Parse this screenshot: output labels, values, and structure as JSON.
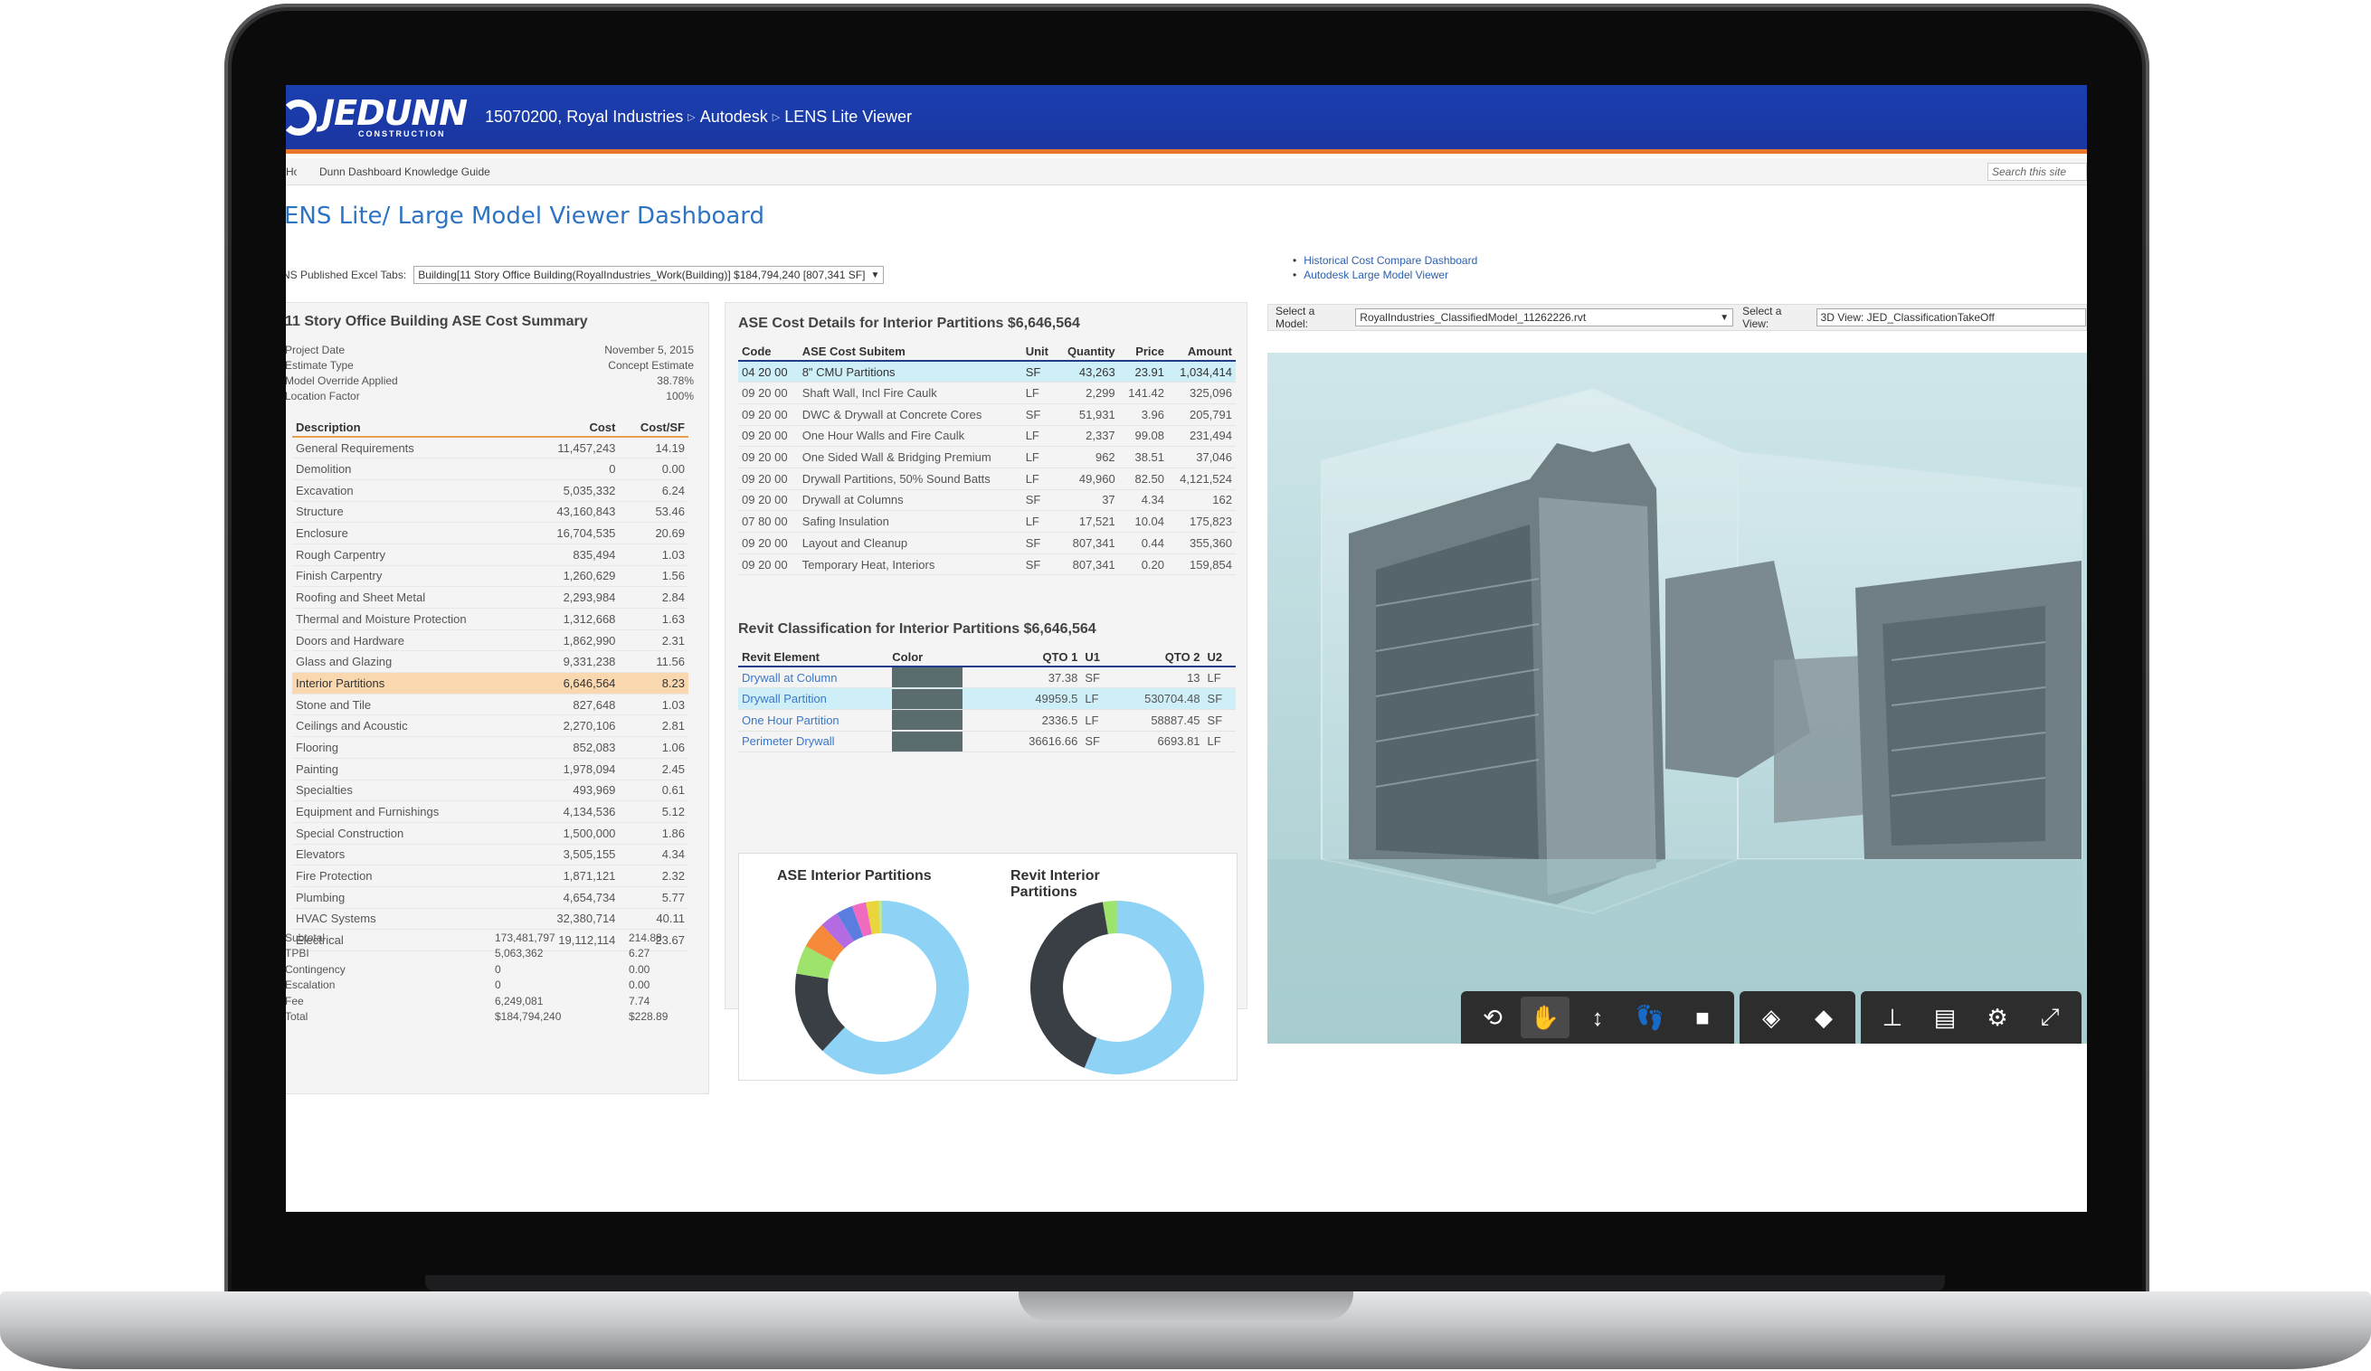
{
  "header": {
    "logo": "JEDUNN",
    "logo_sub": "CONSTRUCTION",
    "breadcrumbs": [
      "15070200, Royal Industries",
      "Autodesk",
      "LENS Lite Viewer"
    ]
  },
  "subnav": {
    "home": "Home",
    "guide": "Dunn Dashboard Knowledge Guide",
    "search_placeholder": "Search this site"
  },
  "page_title": "ENS Lite/ Large Model Viewer Dashboard",
  "links": [
    "Historical Cost Compare Dashboard",
    "Autodesk Large Model Viewer"
  ],
  "excel": {
    "label": "NS Published Excel Tabs:",
    "selected": "Building[11 Story Office Building(RoyalIndustries_Work(Building)] $184,794,240 [807,341 SF]"
  },
  "summary": {
    "title": "11 Story Office Building ASE Cost Summary",
    "project": [
      {
        "k": "Project Date",
        "v": "November 5, 2015"
      },
      {
        "k": "Estimate Type",
        "v": "Concept Estimate"
      },
      {
        "k": "Model Override Applied",
        "v": "38.78%"
      },
      {
        "k": "Location Factor",
        "v": "100%"
      }
    ],
    "headers": [
      "Description",
      "Cost",
      "Cost/SF"
    ],
    "rows": [
      [
        "General Requirements",
        "11,457,243",
        "14.19"
      ],
      [
        "Demolition",
        "0",
        "0.00"
      ],
      [
        "Excavation",
        "5,035,332",
        "6.24"
      ],
      [
        "Structure",
        "43,160,843",
        "53.46"
      ],
      [
        "Enclosure",
        "16,704,535",
        "20.69"
      ],
      [
        "Rough Carpentry",
        "835,494",
        "1.03"
      ],
      [
        "Finish Carpentry",
        "1,260,629",
        "1.56"
      ],
      [
        "Roofing and Sheet Metal",
        "2,293,984",
        "2.84"
      ],
      [
        "Thermal and Moisture Protection",
        "1,312,668",
        "1.63"
      ],
      [
        "Doors and Hardware",
        "1,862,990",
        "2.31"
      ],
      [
        "Glass and Glazing",
        "9,331,238",
        "11.56"
      ],
      [
        "Interior Partitions",
        "6,646,564",
        "8.23"
      ],
      [
        "Stone and Tile",
        "827,648",
        "1.03"
      ],
      [
        "Ceilings and Acoustic",
        "2,270,106",
        "2.81"
      ],
      [
        "Flooring",
        "852,083",
        "1.06"
      ],
      [
        "Painting",
        "1,978,094",
        "2.45"
      ],
      [
        "Specialties",
        "493,969",
        "0.61"
      ],
      [
        "Equipment and Furnishings",
        "4,134,536",
        "5.12"
      ],
      [
        "Special Construction",
        "1,500,000",
        "1.86"
      ],
      [
        "Elevators",
        "3,505,155",
        "4.34"
      ],
      [
        "Fire Protection",
        "1,871,121",
        "2.32"
      ],
      [
        "Plumbing",
        "4,654,734",
        "5.77"
      ],
      [
        "HVAC Systems",
        "32,380,714",
        "40.11"
      ],
      [
        "Electrical",
        "19,112,114",
        "23.67"
      ]
    ],
    "highlight_index": 11,
    "totals": [
      [
        "Subtotal",
        "173,481,797",
        "214.88"
      ],
      [
        "TPBI",
        "5,063,362",
        "6.27"
      ],
      [
        "Contingency",
        "0",
        "0.00"
      ],
      [
        "Escalation",
        "0",
        "0.00"
      ],
      [
        "Fee",
        "6,249,081",
        "7.74"
      ],
      [
        "Total",
        "$184,794,240",
        "$228.89"
      ]
    ]
  },
  "ase": {
    "title": "ASE Cost Details for Interior Partitions $6,646,564",
    "headers": [
      "Code",
      "ASE Cost Subitem",
      "Unit",
      "Quantity",
      "Price",
      "Amount"
    ],
    "rows": [
      [
        "04 20 00",
        "8\" CMU Partitions",
        "SF",
        "43,263",
        "23.91",
        "1,034,414"
      ],
      [
        "09 20 00",
        "Shaft Wall, Incl Fire Caulk",
        "LF",
        "2,299",
        "141.42",
        "325,096"
      ],
      [
        "09 20 00",
        "DWC & Drywall at Concrete Cores",
        "SF",
        "51,931",
        "3.96",
        "205,791"
      ],
      [
        "09 20 00",
        "One Hour Walls and Fire Caulk",
        "LF",
        "2,337",
        "99.08",
        "231,494"
      ],
      [
        "09 20 00",
        "One Sided Wall & Bridging Premium",
        "LF",
        "962",
        "38.51",
        "37,046"
      ],
      [
        "09 20 00",
        "Drywall Partitions, 50% Sound Batts",
        "LF",
        "49,960",
        "82.50",
        "4,121,524"
      ],
      [
        "09 20 00",
        "Drywall at Columns",
        "SF",
        "37",
        "4.34",
        "162"
      ],
      [
        "07 80 00",
        "Safing Insulation",
        "LF",
        "17,521",
        "10.04",
        "175,823"
      ],
      [
        "09 20 00",
        "Layout and Cleanup",
        "SF",
        "807,341",
        "0.44",
        "355,360"
      ],
      [
        "09 20 00",
        "Temporary Heat, Interiors",
        "SF",
        "807,341",
        "0.20",
        "159,854"
      ]
    ]
  },
  "revit": {
    "title": "Revit Classification for Interior Partitions $6,646,564",
    "headers": [
      "Revit Element",
      "Color",
      "QTO 1",
      "U1",
      "QTO 2",
      "U2"
    ],
    "rows": [
      [
        "Drywall at Column",
        "",
        "37.38",
        "SF",
        "13",
        "LF"
      ],
      [
        "Drywall Partition",
        "",
        "49959.5",
        "LF",
        "530704.48",
        "SF"
      ],
      [
        "One Hour Partition",
        "",
        "2336.5",
        "LF",
        "58887.45",
        "SF"
      ],
      [
        "Perimeter Drywall",
        "",
        "36616.66",
        "SF",
        "6693.81",
        "LF"
      ]
    ]
  },
  "charts": {
    "left_title": "ASE Interior Partitions",
    "right_title": "Revit Interior Partitions"
  },
  "chart_data": [
    {
      "type": "pie",
      "title": "ASE Interior Partitions",
      "values": [
        4121524,
        1034414,
        355360,
        325096,
        231494,
        205791,
        175823,
        159854,
        37046,
        162
      ],
      "colors": [
        "#8ed3f5",
        "#3a3f46",
        "#9ee36c",
        "#f48a3a",
        "#b46ae0",
        "#5c7de0",
        "#f06bbf",
        "#e8d63a",
        "#b9e8a0",
        "#6fc0f2"
      ]
    },
    {
      "type": "pie",
      "title": "Revit Interior Partitions",
      "values": [
        49959.5,
        36616.66,
        2336.5,
        37.38
      ],
      "colors": [
        "#8ed3f5",
        "#3a3f46",
        "#9ee36c",
        "#6fc0f2"
      ]
    }
  ],
  "model": {
    "label": "Select a Model:",
    "selected": "RoyalIndustries_ClassifiedModel_11262226.rvt",
    "view_label": "Select a View:",
    "view_selected": "3D View: JED_ClassificationTakeOff"
  },
  "toolbar_icons": [
    [
      "orbit-icon",
      "pan-icon",
      "zoom-icon",
      "first-person-icon",
      "camera-icon"
    ],
    [
      "explode-icon",
      "section-icon"
    ],
    [
      "model-browser-icon",
      "properties-icon",
      "settings-icon",
      "fullscreen-icon"
    ]
  ]
}
